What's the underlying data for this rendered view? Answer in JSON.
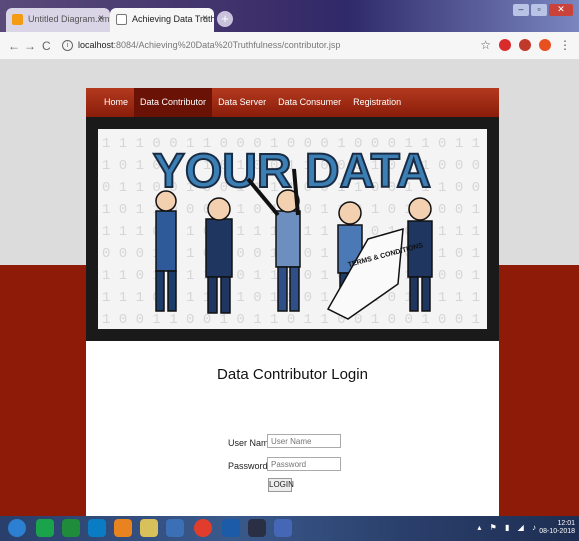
{
  "browser": {
    "tabs": [
      {
        "title": "Untitled Diagram.xml - draw.io"
      },
      {
        "title": "Achieving Data Truthfulness"
      }
    ],
    "tab_close": "×",
    "new_tab": "+",
    "address": {
      "host": "localhost",
      "path": ":8084/Achieving%20Data%20Truthfulness/contributor.jsp"
    },
    "window_controls": [
      "–",
      "▫",
      "✕"
    ]
  },
  "nav": {
    "items": [
      "Home",
      "Data Contributor",
      "Data Server",
      "Data Consumer",
      "Registration"
    ],
    "active_index": 1
  },
  "banner": {
    "headline": "YOUR DATA",
    "sign_text": "TERMS & CONDITIONS"
  },
  "login": {
    "title": "Data Contributor Login",
    "username_label": "User Name",
    "username_placeholder": "User Name",
    "password_label": "Password",
    "password_placeholder": "Password",
    "button_label": "LOGIN"
  },
  "taskbar": {
    "time": "12:01",
    "date": "08-10-2018"
  },
  "colors": {
    "accent": "#8e1a08",
    "nav_active": "#6b1206"
  }
}
